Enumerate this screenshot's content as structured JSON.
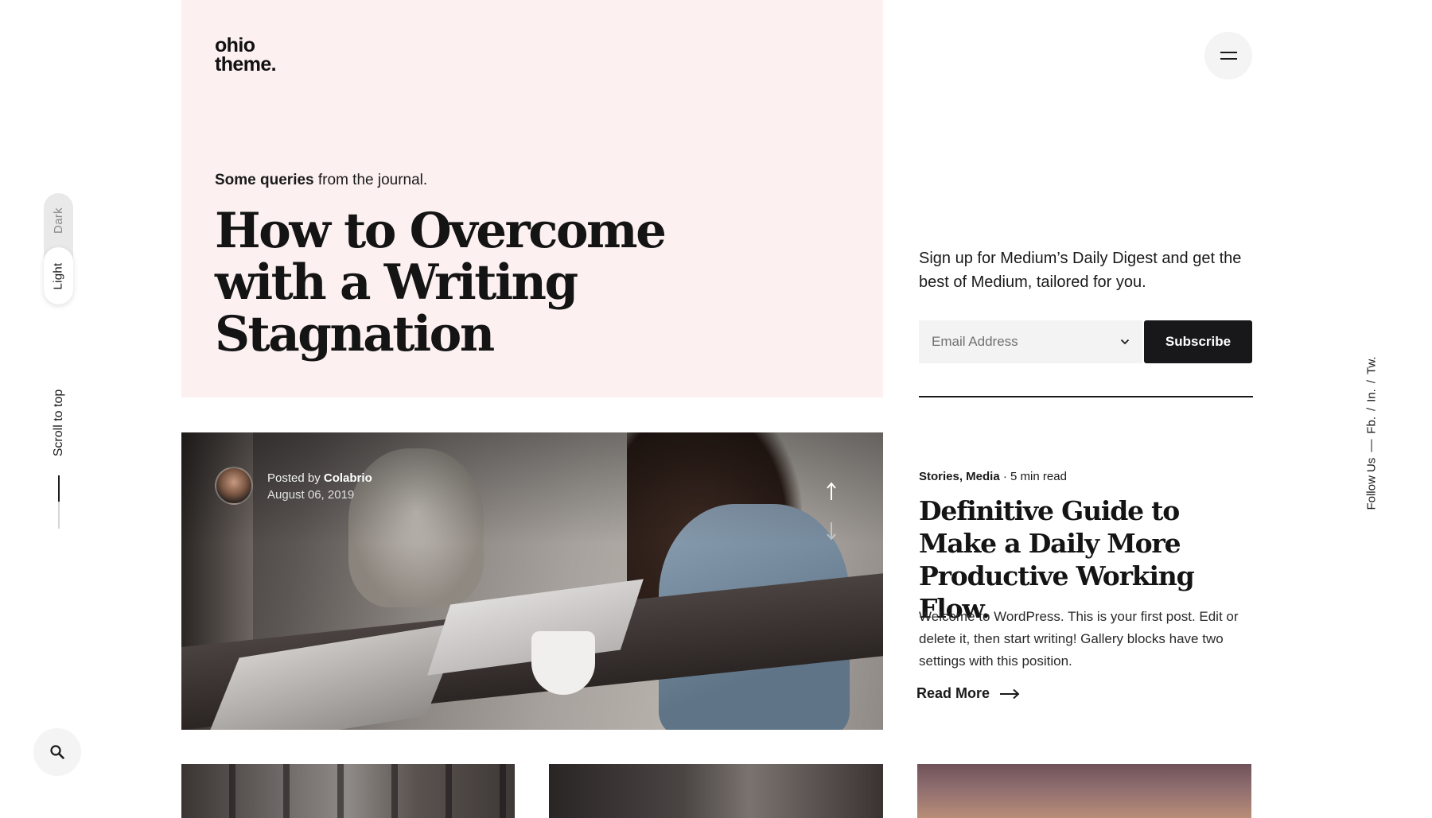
{
  "logo": {
    "line1": "ohio",
    "line2": "theme."
  },
  "mode_switch": {
    "dark": "Dark",
    "light": "Light",
    "active": "Light"
  },
  "scroll_top": {
    "label": "Scroll to top"
  },
  "hero": {
    "kicker_bold": "Some queries",
    "kicker_rest": "from the journal.",
    "title": "How to Overcome with a Writing Stagnation"
  },
  "subscribe": {
    "text": "Sign up for Medium’s Daily Digest and get the best of Medium, tailored for you.",
    "email_placeholder": "Email Address",
    "button": "Subscribe"
  },
  "featured": {
    "posted_by_prefix": "Posted by",
    "author": "Colabrio",
    "date": "August 06, 2019"
  },
  "post": {
    "categories": "Stories, Media",
    "read_time": "5 min read",
    "separator": "·",
    "title": "Definitive Guide to Make a Daily More Productive Working Flow.",
    "excerpt": "Welcome to WordPress. This is your first post. Edit or delete it, then start writing! Gallery blocks have two settings with this position.",
    "read_more": "Read More"
  },
  "social": {
    "label": "Follow Us",
    "links": [
      "Fb.",
      "In.",
      "Tw."
    ],
    "sep": "/"
  },
  "colors": {
    "hero_bg": "#fcf0f1",
    "button_dark": "#18181a",
    "text": "#1a1a1a"
  },
  "icons": {
    "search": "search-icon",
    "menu": "hamburger-menu-icon",
    "arrow_up": "arrow-up-icon",
    "arrow_down": "arrow-down-icon",
    "read_more": "arrow-right-icon",
    "select": "chevron-down-icon"
  }
}
